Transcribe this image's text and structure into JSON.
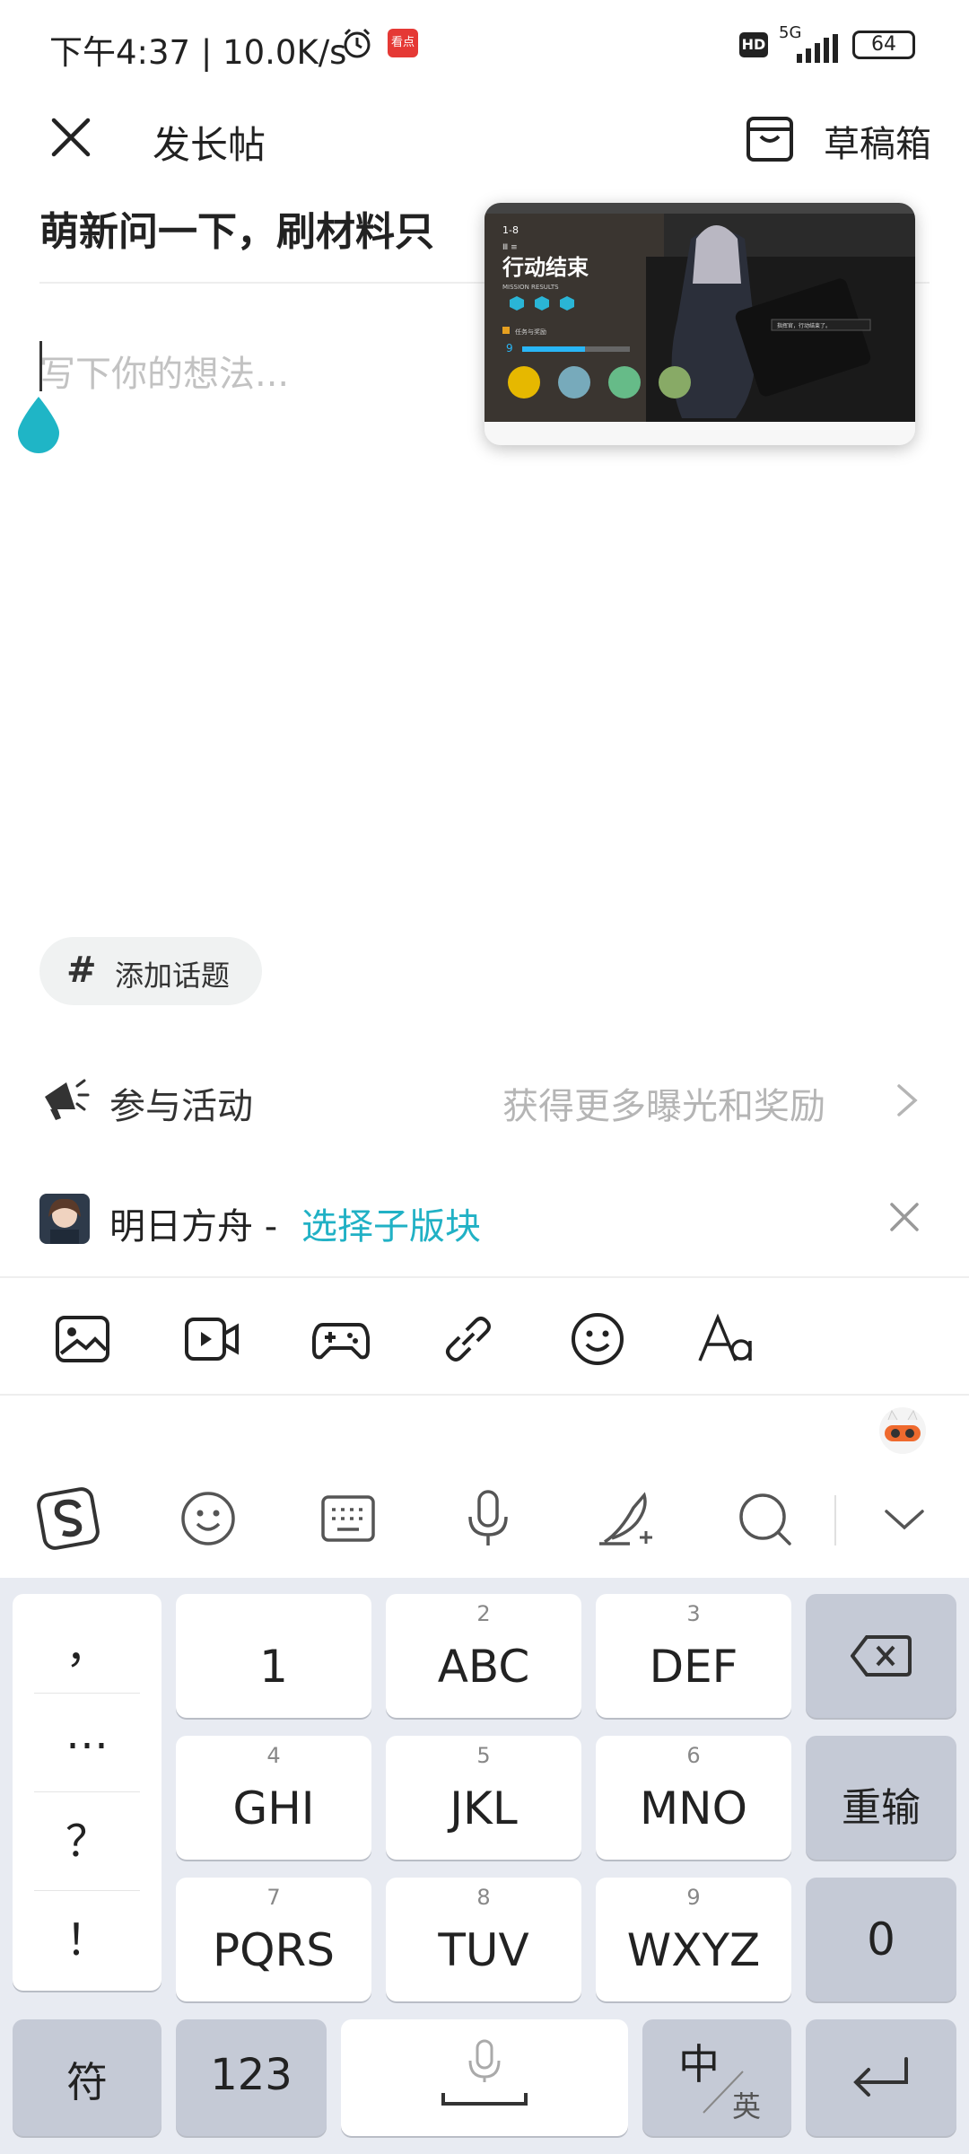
{
  "status_bar": {
    "time_speed": "下午4:37 | 10.0K/s",
    "kandian_badge": "看点",
    "hd": "HD",
    "network": "5G",
    "battery": "64"
  },
  "header": {
    "title": "发长帖",
    "drafts_label": "草稿箱"
  },
  "editor": {
    "title_text": "萌新问一下，刷材料只",
    "body_placeholder": "写下你的想法..."
  },
  "preview_card": {
    "stage": "1-8",
    "rank": "Ⅲ ≡",
    "headline": "行动结束",
    "subheadline": "MISSION RESULTS",
    "level": "9",
    "rewards_label": "任务与奖励",
    "chat_line": "指挥官，行动结束了。"
  },
  "topic": {
    "hash": "#",
    "label": "添加话题"
  },
  "activity": {
    "label": "参与活动",
    "hint": "获得更多曝光和奖励"
  },
  "board": {
    "name": "明日方舟 - ",
    "select_label": "选择子版块"
  },
  "toolbar": {
    "icons": [
      "image-icon",
      "video-icon",
      "game-icon",
      "link-icon",
      "emoji-icon",
      "text-format-icon"
    ]
  },
  "ime_bar": {
    "icons": [
      "sogou-logo-icon",
      "emoji-icon",
      "keyboard-icon",
      "microphone-icon",
      "handwriting-icon",
      "search-icon",
      "collapse-icon"
    ]
  },
  "keyboard": {
    "punctuation": [
      "，",
      "…",
      "？",
      "！"
    ],
    "rows": [
      [
        {
          "num": "",
          "label": "1"
        },
        {
          "num": "2",
          "label": "ABC"
        },
        {
          "num": "3",
          "label": "DEF"
        }
      ],
      [
        {
          "num": "4",
          "label": "GHI"
        },
        {
          "num": "5",
          "label": "JKL"
        },
        {
          "num": "6",
          "label": "MNO"
        }
      ],
      [
        {
          "num": "7",
          "label": "PQRS"
        },
        {
          "num": "8",
          "label": "TUV"
        },
        {
          "num": "9",
          "label": "WXYZ"
        }
      ]
    ],
    "reinput": "重输",
    "zero": "0",
    "symbols": "符",
    "numbers": "123",
    "lang_main": "中",
    "lang_alt": "英"
  },
  "colors": {
    "accent": "#21b1c5",
    "keyboard_bg": "#e8ebf2",
    "dark_key": "#c5cad6"
  }
}
